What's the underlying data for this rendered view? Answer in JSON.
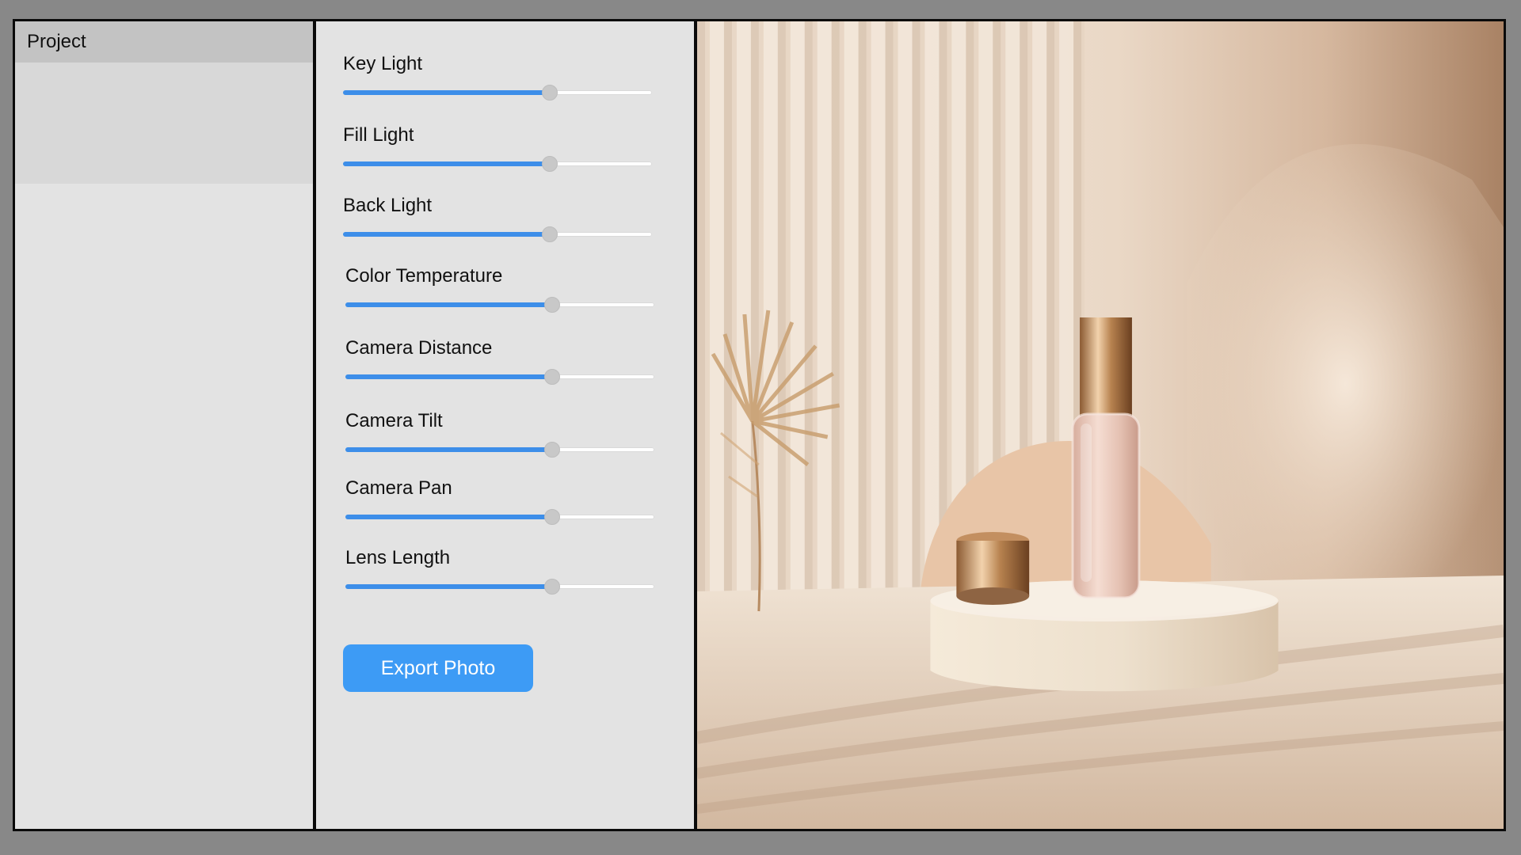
{
  "project": {
    "title": "Project"
  },
  "controls": {
    "sliders": [
      {
        "label": "Key Light",
        "value": 0.67
      },
      {
        "label": "Fill Light",
        "value": 0.67
      },
      {
        "label": "Back Light",
        "value": 0.67
      },
      {
        "label": "Color Temperature",
        "value": 0.67
      },
      {
        "label": "Camera Distance",
        "value": 0.67
      },
      {
        "label": "Camera Tilt",
        "value": 0.67
      },
      {
        "label": "Camera Pan",
        "value": 0.67
      },
      {
        "label": "Lens Length",
        "value": 0.67
      }
    ],
    "export_label": "Export Photo"
  },
  "colors": {
    "accent": "#3d8ee9",
    "button": "#3d9bf5",
    "border": "#0a0a0a",
    "panel_bg": "#e3e3e3",
    "project_header_bg": "#c3c3c3"
  },
  "preview": {
    "icon": "product-photo-preview"
  }
}
